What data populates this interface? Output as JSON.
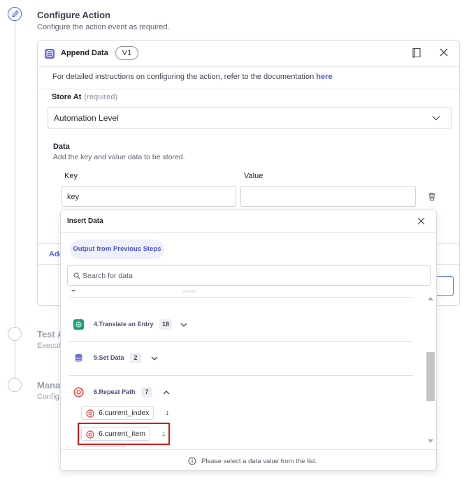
{
  "steps": [
    {
      "title": "Configure Action",
      "subtitle": "Configure the action event as required."
    },
    {
      "title": "Test A",
      "subtitle": "Execut"
    },
    {
      "title": "Mana",
      "subtitle": "Config"
    }
  ],
  "card": {
    "title": "Append Data",
    "version": "V1",
    "info_text": "For detailed instructions on configuring the action, refer to the documentation ",
    "info_link": "here",
    "store_at_label": "Store At",
    "store_at_required": "(required)",
    "store_at_value": "Automation Level",
    "data_label": "Data",
    "data_help": "Add the key and value data to be stored.",
    "key_header": "Key",
    "value_header": "Value",
    "key_value": "key",
    "value_value": "",
    "add_link": "Add"
  },
  "popover": {
    "title": "Insert Data",
    "tab_label": "Output from Previous Steps",
    "search_placeholder": "Search for data",
    "steps": [
      {
        "name": "4.Translate an Entry",
        "count": "18",
        "icon": "translate-icon",
        "color": "#1f9d7a"
      },
      {
        "name": "5.Set Data",
        "count": "2",
        "icon": "database-icon",
        "color": "#6b6fd6"
      },
      {
        "name": "6.Repeat Path",
        "count": "7",
        "icon": "repeat-icon",
        "color": "#e0574f"
      }
    ],
    "items": [
      {
        "label": "6.current_index",
        "count": "1"
      },
      {
        "label": "6.current_item",
        "count": "1"
      }
    ],
    "footer_text": "Please select a data value from the list."
  },
  "colors": {
    "accent": "#4a67e8",
    "highlight": "#d01c1c",
    "link": "#4b5bd6"
  }
}
